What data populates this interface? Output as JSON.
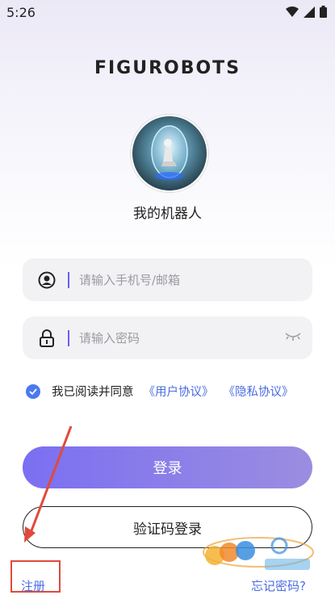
{
  "status_bar": {
    "time": "5:26"
  },
  "logo_text": "FIGUROBOTS",
  "robot_name": "我的机器人",
  "phone_field": {
    "placeholder": "请输入手机号/邮箱"
  },
  "password_field": {
    "placeholder": "请输入密码"
  },
  "agreement": {
    "text": "我已阅读并同意",
    "user_agreement": "《用户协议》",
    "privacy_policy": "《隐私协议》",
    "checked": true
  },
  "login_button": "登录",
  "code_login_button": "验证码登录",
  "register_link": "注册",
  "forgot_link": "忘记密码?",
  "colors": {
    "accent": "#7b6ff2",
    "link": "#4a6de0",
    "highlight": "#e04a3a"
  }
}
